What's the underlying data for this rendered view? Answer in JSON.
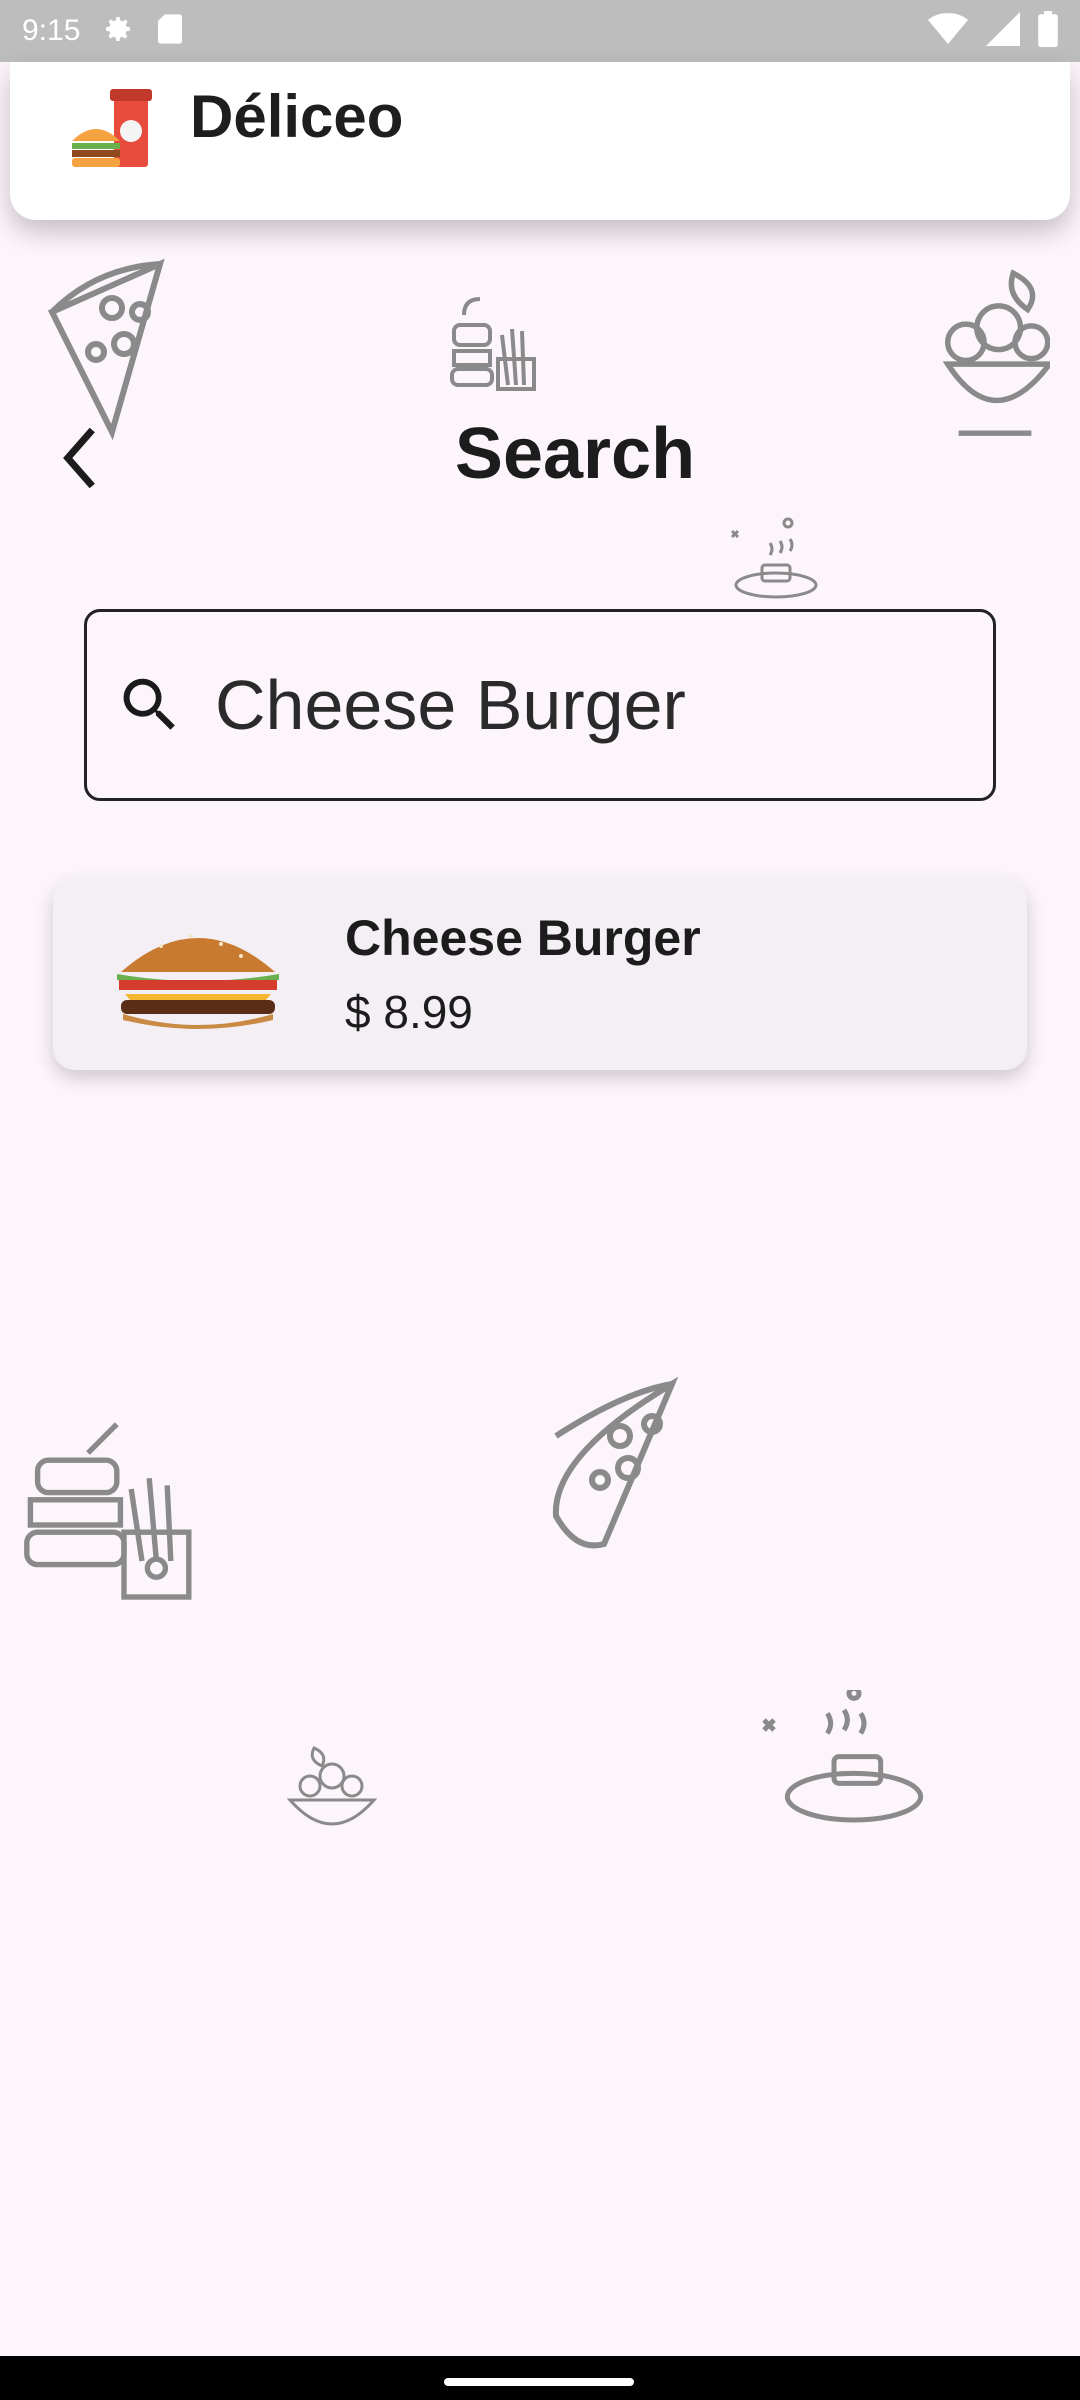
{
  "status_bar": {
    "time": "9:15",
    "left_icons": [
      "gear-icon",
      "sd-card-icon"
    ],
    "right_icons": [
      "wifi-icon",
      "signal-icon",
      "battery-icon"
    ]
  },
  "app_bar": {
    "title": "Déliceo",
    "logo_icon": "burger-drink-logo"
  },
  "header": {
    "back_icon": "chevron-left-icon",
    "title": "Search"
  },
  "search": {
    "icon": "search-icon",
    "value": "Cheese Burger"
  },
  "results": [
    {
      "name": "Cheese Burger",
      "price": "$ 8.99",
      "image": "cheese-burger-image"
    }
  ],
  "colors": {
    "background": "#fcf5fc",
    "status_bar": "#bdbdbd",
    "card": "#f3eff5",
    "text": "#1c1c1c",
    "doodle": "#8a8a8a"
  }
}
